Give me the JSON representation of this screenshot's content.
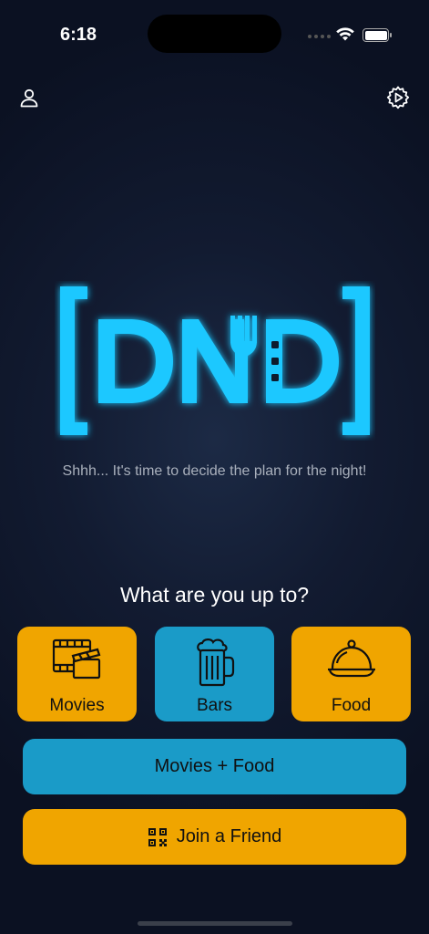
{
  "status_bar": {
    "time": "6:18"
  },
  "logo": {
    "text": "DND",
    "accent_color": "#1ec8ff"
  },
  "tagline": "Shhh... It's time to decide the plan for the night!",
  "question": "What are you up to?",
  "tiles": [
    {
      "label": "Movies",
      "icon": "movie-clapper-icon",
      "color": "#f0a500"
    },
    {
      "label": "Bars",
      "icon": "beer-mug-icon",
      "color": "#1a9bc8"
    },
    {
      "label": "Food",
      "icon": "food-cloche-icon",
      "color": "#f0a500"
    }
  ],
  "combo_button": {
    "label": "Movies + Food",
    "color": "#1a9bc8"
  },
  "join_button": {
    "label": "Join a Friend",
    "icon": "qr-code-icon",
    "color": "#f0a500"
  },
  "colors": {
    "background": "#121b31",
    "orange": "#f0a500",
    "blue": "#1a9bc8"
  }
}
